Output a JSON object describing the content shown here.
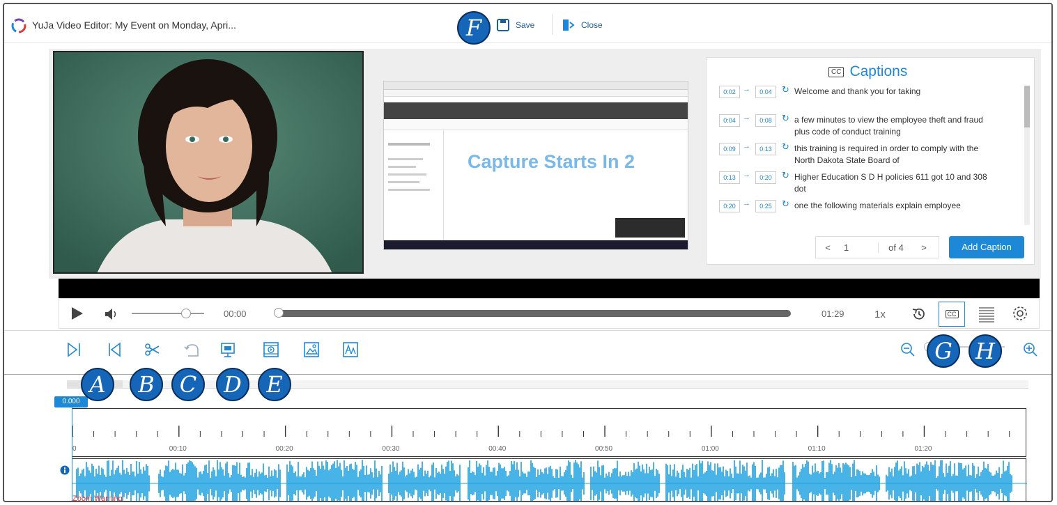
{
  "window": {
    "title": "YuJa Video Editor: My Event on Monday, Apri...",
    "save_label": "Save",
    "close_label": "Close"
  },
  "screen_capture": {
    "overlay_text": "Capture Starts In 2"
  },
  "captions": {
    "heading": "Captions",
    "cc_badge": "CC",
    "items": [
      {
        "start": "0:02",
        "end": "0:04",
        "text": "Welcome and thank you for taking"
      },
      {
        "start": "0:04",
        "end": "0:08",
        "text": "a few minutes to view the employee theft and fraud plus code of conduct training"
      },
      {
        "start": "0:09",
        "end": "0:13",
        "text": "this training is required in order to comply with the North Dakota State Board of"
      },
      {
        "start": "0:13",
        "end": "0:20",
        "text": "Higher Education S D H policies 611 got 10 and 308 dot"
      },
      {
        "start": "0:20",
        "end": "0:25",
        "text": "one the following materials explain employee"
      }
    ],
    "pager": {
      "prev": "<",
      "page": "1",
      "of": "of 4",
      "next": ">"
    },
    "add_label": "Add Caption"
  },
  "player": {
    "current_time": "00:00",
    "duration": "01:29",
    "speed": "1x",
    "volume_fraction": 0.75,
    "progress_fraction": 0.0
  },
  "timeline": {
    "playhead": "0.000",
    "ruler_labels": [
      "0",
      "00:10",
      "00:20",
      "00:30",
      "00:40",
      "00:50",
      "01:00",
      "01:10",
      "01:20"
    ],
    "zoom_warning": "Zoom Warning"
  },
  "badges": [
    "A",
    "B",
    "C",
    "D",
    "E",
    "F",
    "G",
    "H"
  ],
  "colors": {
    "accent": "#1e88d8",
    "wave": "#1aa0e0",
    "badge": "#1565b8",
    "warning": "#e53935"
  }
}
